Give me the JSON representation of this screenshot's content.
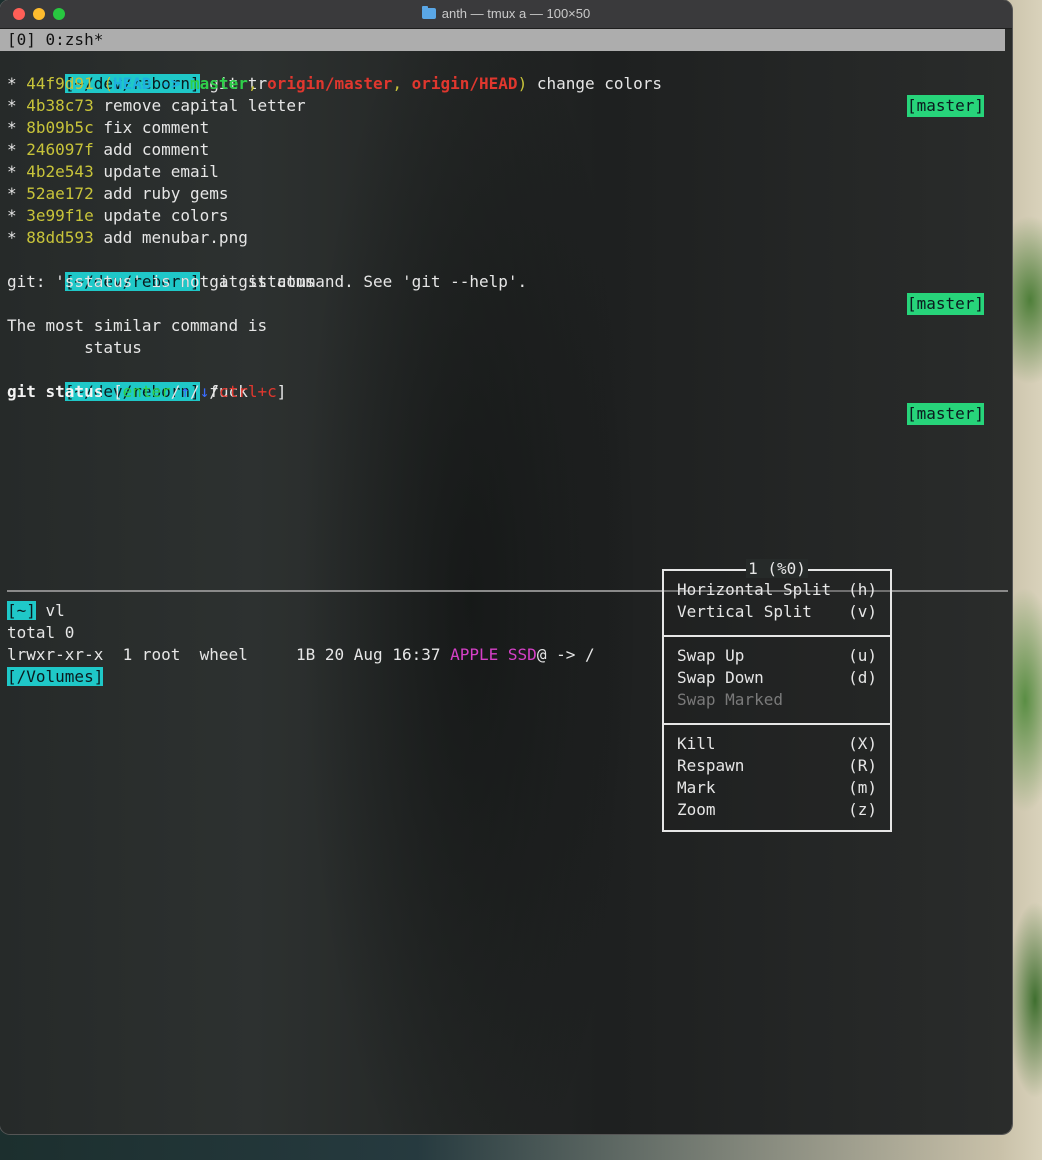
{
  "window": {
    "title": "anth — tmux a — 100×50"
  },
  "tmux_status": "[0] 0:zsh*",
  "top_pane": {
    "prompt1": {
      "path": "[~/dev/reborn]",
      "command": " git tr",
      "branch": "[master]"
    },
    "log": [
      {
        "star": "* ",
        "hash": "44f9d91",
        "message": " change colors"
      },
      {
        "star": "* ",
        "hash": "4b38c73",
        "message": " remove capital letter"
      },
      {
        "star": "* ",
        "hash": "8b09b5c",
        "message": " fix comment"
      },
      {
        "star": "* ",
        "hash": "246097f",
        "message": " add comment"
      },
      {
        "star": "* ",
        "hash": "4b2e543",
        "message": " update email"
      },
      {
        "star": "* ",
        "hash": "52ae172",
        "message": " add ruby gems"
      },
      {
        "star": "* ",
        "hash": "3e99f1e",
        "message": " update colors"
      },
      {
        "star": "* ",
        "hash": "88dd593",
        "message": " add menubar.png"
      }
    ],
    "refs": {
      "open": " (",
      "head": "HEAD -> ",
      "master": "master",
      "sep1": ", ",
      "origin_master": "origin/master",
      "sep2": ", ",
      "origin_head": "origin/HEAD",
      "close": ")"
    },
    "prompt2": {
      "path": "[~/dev/reborn]",
      "command": " git sstatus",
      "branch": "[master]"
    },
    "error": "git: 'sstatus' is not a git command. See 'git --help'.",
    "similar": "The most similar command is",
    "suggestion": "        status",
    "prompt3": {
      "path": "[~/dev/reborn]",
      "command": " fuck",
      "branch": "[master]"
    },
    "fuck_line": {
      "command": "git status",
      "open": " [",
      "enter": "enter",
      "slash1": "/",
      "up": "↑",
      "slash2": "/",
      "down": "↓",
      "slash3": "/",
      "ctrlc": "ctrl+c",
      "close": "]"
    }
  },
  "bottom_pane": {
    "prompt": {
      "path": "[~]",
      "command": " vl"
    },
    "total": "total 0",
    "entry": {
      "prefix": "lrwxr-xr-x  1 root  wheel     1B 20 Aug 16:37 ",
      "name": "APPLE SSD",
      "suffix": "@ -> /"
    },
    "prompt2": {
      "path": "[/Volumes]"
    }
  },
  "pane_menu": {
    "title": "1 (%0)",
    "groups": [
      [
        {
          "label": "Horizontal Split",
          "key": "(h)"
        },
        {
          "label": "Vertical Split",
          "key": "(v)"
        }
      ],
      [
        {
          "label": "Swap Up",
          "key": "(u)"
        },
        {
          "label": "Swap Down",
          "key": "(d)"
        },
        {
          "label": "Swap Marked",
          "key": ""
        }
      ],
      [
        {
          "label": "Kill",
          "key": "(X)"
        },
        {
          "label": "Respawn",
          "key": "(R)"
        },
        {
          "label": "Mark",
          "key": "(m)"
        },
        {
          "label": "Zoom",
          "key": "(z)"
        }
      ]
    ]
  }
}
